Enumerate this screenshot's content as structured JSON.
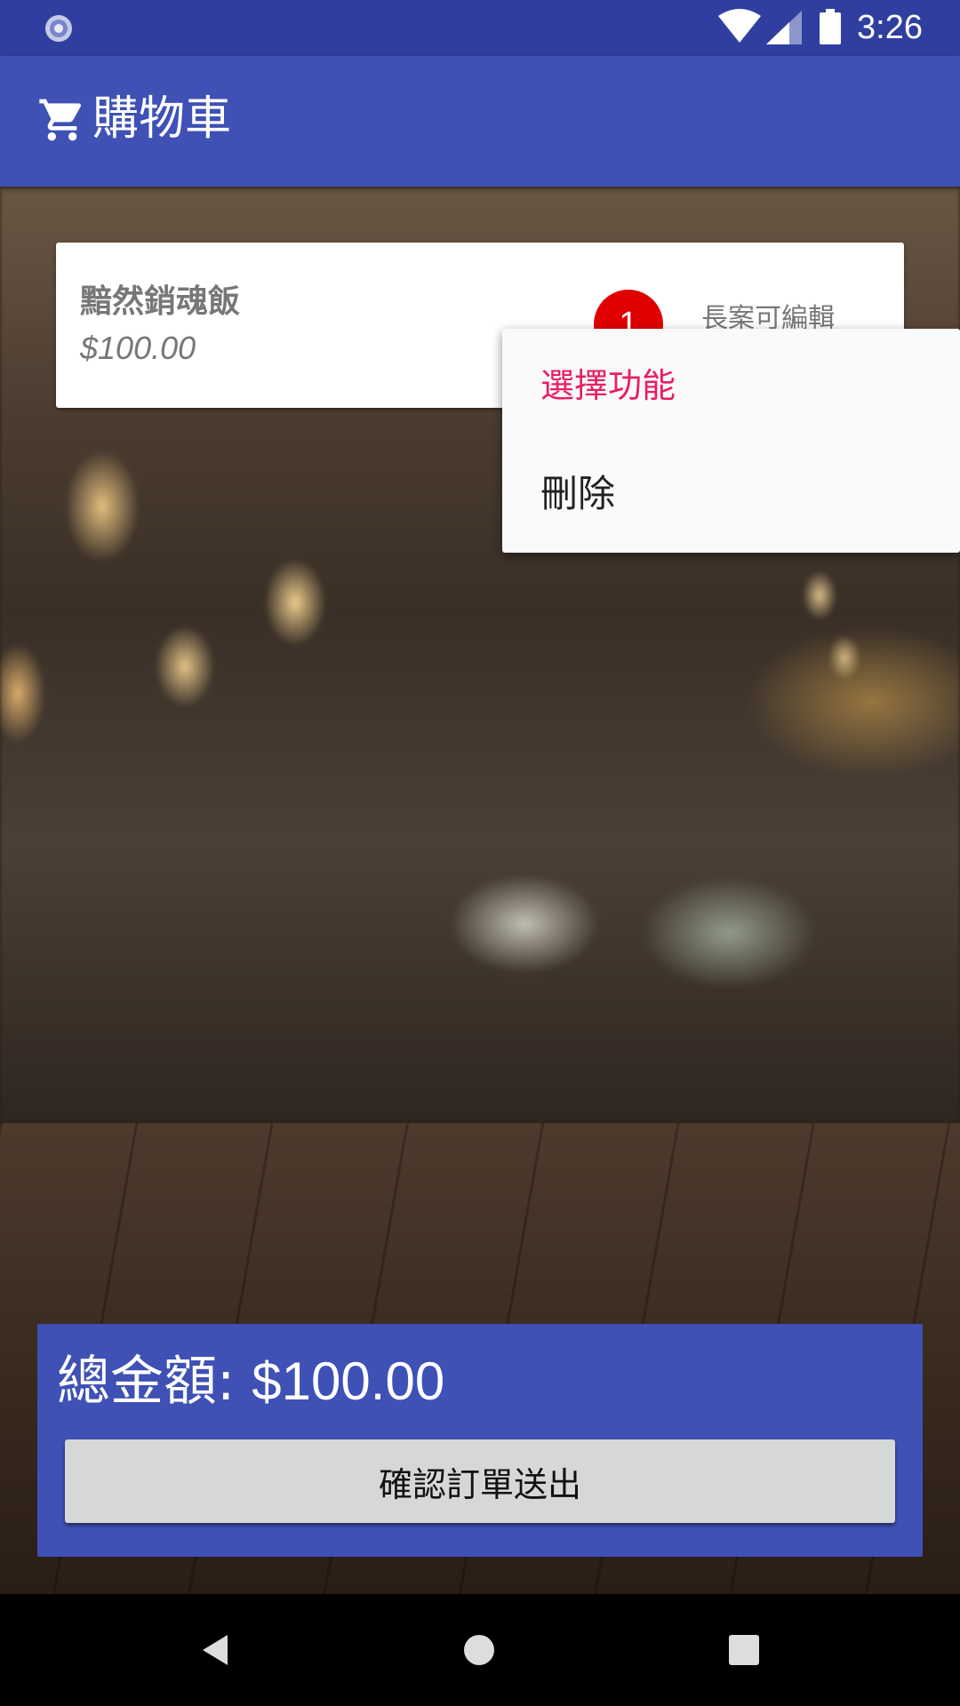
{
  "status_bar": {
    "time": "3:26",
    "icons": [
      "sync-icon",
      "wifi-icon",
      "signal-icon",
      "battery-icon"
    ]
  },
  "app_bar": {
    "icon": "cart-icon",
    "title": "購物車"
  },
  "cart_items": [
    {
      "name": "黯然銷魂飯",
      "price": "$100.00",
      "quantity": "1",
      "hint": "長案可編輯"
    }
  ],
  "context_menu": {
    "title": "選擇功能",
    "items": [
      "刪除"
    ]
  },
  "total": {
    "label": "總金額:",
    "amount": "$100.00"
  },
  "submit_button": {
    "label": "確認訂單送出"
  },
  "nav_bar": {
    "icons": [
      "back-icon",
      "home-icon",
      "recents-icon"
    ]
  },
  "colors": {
    "status_bar": "#303f9f",
    "app_bar": "#3f51b5",
    "badge": "#e00000",
    "menu_title": "#e91e63",
    "button": "#d6d7d7"
  }
}
